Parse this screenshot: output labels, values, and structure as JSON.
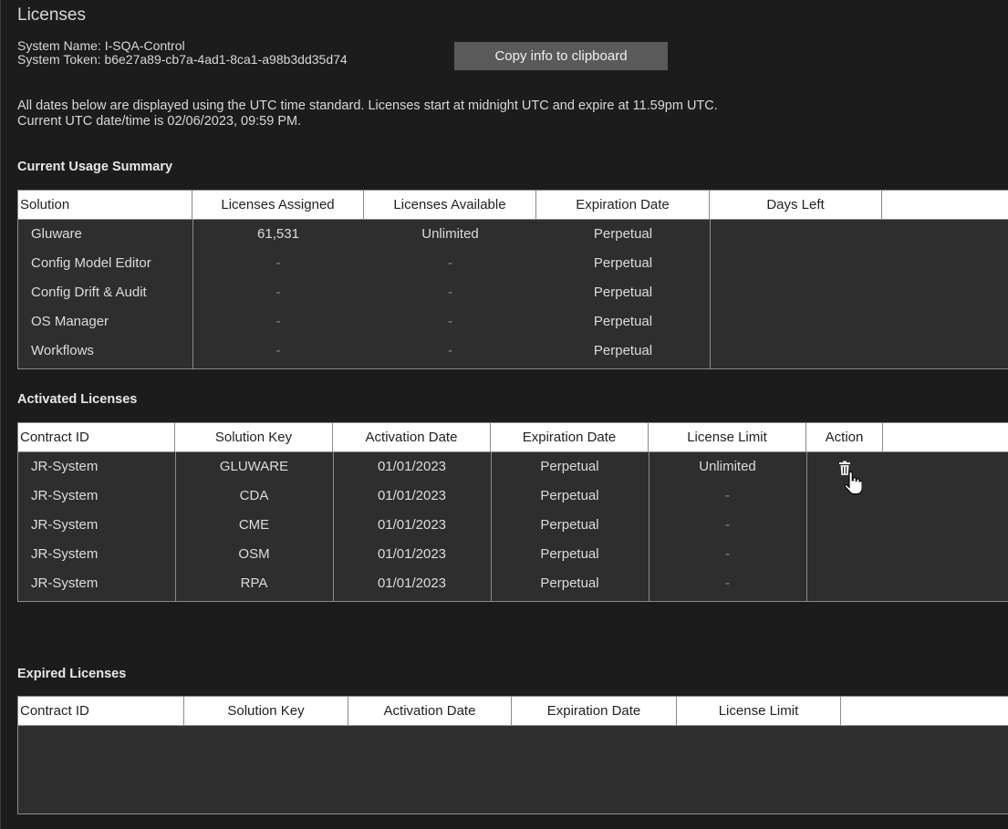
{
  "title": "Licenses",
  "system": {
    "name_line": "System Name: I-SQA-Control",
    "token_line": "System Token: b6e27a89-cb7a-4ad1-8ca1-a98b3dd35d74"
  },
  "copy_button": "Copy info to clipboard",
  "notes": {
    "line1": "All dates below are displayed using the UTC time standard. Licenses start at midnight UTC and expire at 11.59pm UTC.",
    "line2": "Current UTC date/time is 02/06/2023, 09:59 PM."
  },
  "usage": {
    "title": "Current Usage Summary",
    "headers": [
      "Solution",
      "Licenses Assigned",
      "Licenses Available",
      "Expiration Date",
      "Days Left"
    ],
    "rows": [
      [
        "Gluware",
        "61,531",
        "Unlimited",
        "Perpetual",
        ""
      ],
      [
        "Config Model Editor",
        "-",
        "-",
        "Perpetual",
        ""
      ],
      [
        "Config Drift & Audit",
        "-",
        "-",
        "Perpetual",
        ""
      ],
      [
        "OS Manager",
        "-",
        "-",
        "Perpetual",
        ""
      ],
      [
        "Workflows",
        "-",
        "-",
        "Perpetual",
        ""
      ]
    ]
  },
  "activated": {
    "title": "Activated Licenses",
    "headers": [
      "Contract ID",
      "Solution Key",
      "Activation Date",
      "Expiration Date",
      "License Limit",
      "Action"
    ],
    "rows": [
      [
        "JR-System",
        "GLUWARE",
        "01/01/2023",
        "Perpetual",
        "Unlimited",
        "trash-icon"
      ],
      [
        "JR-System",
        "CDA",
        "01/01/2023",
        "Perpetual",
        "-",
        ""
      ],
      [
        "JR-System",
        "CME",
        "01/01/2023",
        "Perpetual",
        "-",
        ""
      ],
      [
        "JR-System",
        "OSM",
        "01/01/2023",
        "Perpetual",
        "-",
        ""
      ],
      [
        "JR-System",
        "RPA",
        "01/01/2023",
        "Perpetual",
        "-",
        ""
      ]
    ]
  },
  "expired": {
    "title": "Expired Licenses",
    "headers": [
      "Contract ID",
      "Solution Key",
      "Activation Date",
      "Expiration Date",
      "License Limit"
    ],
    "rows": []
  }
}
